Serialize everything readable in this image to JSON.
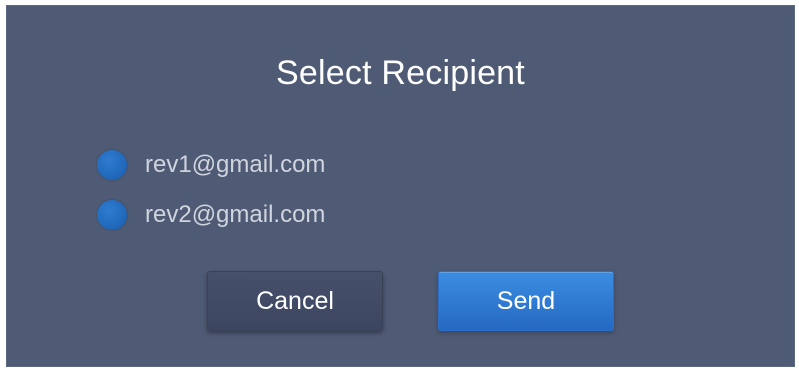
{
  "dialog": {
    "title": "Select Recipient",
    "recipients": [
      {
        "label": "rev1@gmail.com"
      },
      {
        "label": "rev2@gmail.com"
      }
    ],
    "cancel_label": "Cancel",
    "send_label": "Send"
  },
  "colors": {
    "background": "#4f5a74",
    "accent": "#2f7cd0",
    "send_button": "#3c8de2"
  },
  "icons": {
    "radio": "radio-button-icon"
  }
}
